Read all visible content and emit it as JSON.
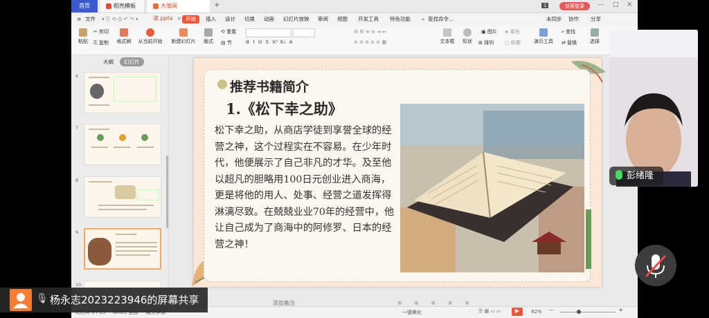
{
  "tabs": {
    "home": "首页",
    "templates": "稻壳模板",
    "file": "大咖阅读.pptx"
  },
  "title_badge": "1",
  "login_button": "访客登录",
  "menu": {
    "file": "文件",
    "start": "开始",
    "insert": "插入",
    "design": "设计",
    "transition": "切换",
    "animation": "动画",
    "slideshow": "幻灯片放映",
    "review": "审阅",
    "view": "视图",
    "developer": "开发工具",
    "special": "特色功能",
    "search": "查找命令..."
  },
  "menu_right": {
    "sync": "未同步",
    "collab": "协作",
    "share": "分享"
  },
  "ribbon": {
    "cut": "剪切",
    "paste": "粘贴",
    "copy": "复制",
    "format_painter": "格式刷",
    "from_current": "从当前开始",
    "new_slide": "新建幻灯片",
    "layout": "版式",
    "section": "节",
    "reset": "重置",
    "textbox": "文本框",
    "shape": "形状",
    "arrange": "排列",
    "picture": "图片",
    "fill": "填充",
    "outline": "轮廓",
    "find": "查找",
    "replace": "替换",
    "select": "选择",
    "presentation_tools": "演示工具"
  },
  "leftpanel": {
    "outline_tab": "大纲",
    "slides_tab": "幻灯片",
    "thumb_numbers": [
      "6",
      "7",
      "8",
      "9",
      "10"
    ]
  },
  "slide": {
    "title": "推荐书籍简介",
    "subtitle": "1.《松下幸之助》",
    "body": "松下幸之助，从商店学徒到享誉全球的经营之神，这个过程实在不容易。在少年时代，他便展示了自己非凡的才华。及至他以超凡的胆略用100日元创业进入商海，更是将他的用人、处事、经营之道发挥得淋漓尽致。在兢兢业业70年的经营中，他让自己成为了商海中的阿修罗、日本的经营之神！"
  },
  "notes_hint": "添加备注",
  "status": {
    "slide_count": "幻灯片 5 / 13",
    "theme": "Office 主题",
    "missing_font": "缺失字体",
    "beautify": "一键美化",
    "zoom": "82%"
  },
  "video": {
    "name": "彭绪隆"
  },
  "share": {
    "text": "杨永志2023223946的屏幕共享"
  },
  "colors": {
    "accent": "#e8573c",
    "home_tab": "#3c5bd1"
  }
}
